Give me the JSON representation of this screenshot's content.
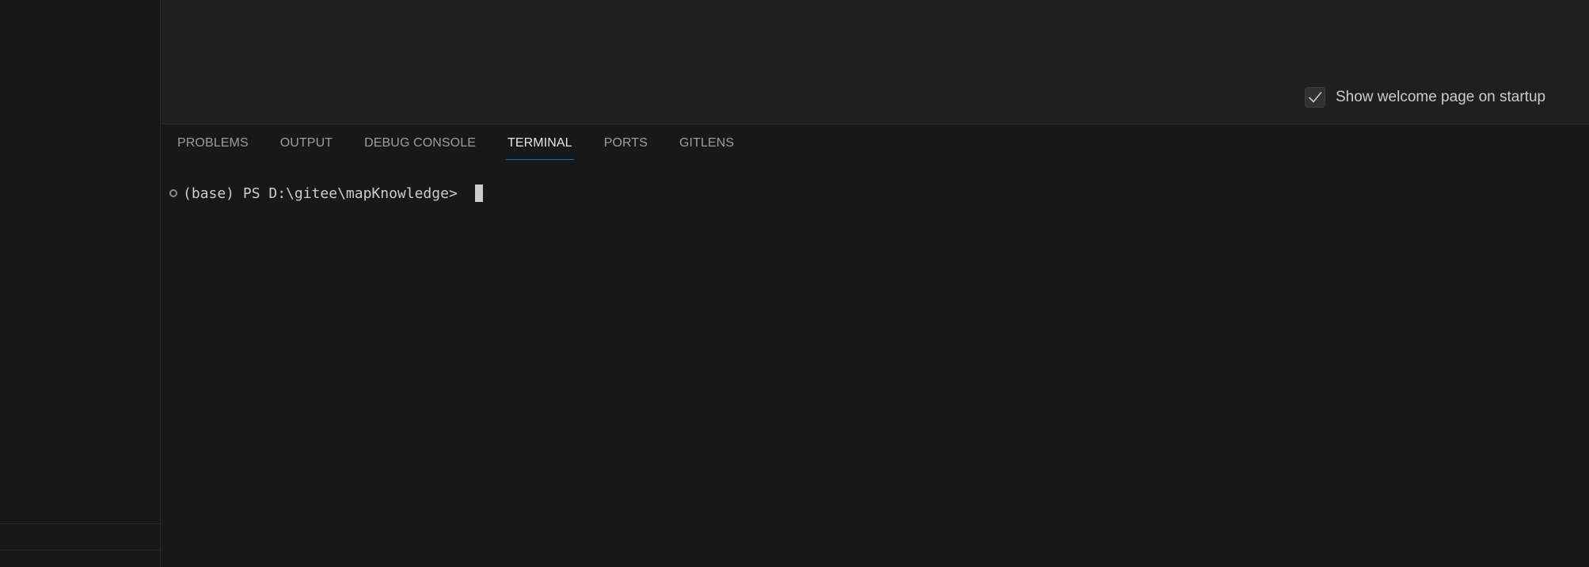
{
  "welcome": {
    "show_on_startup_label": "Show welcome page on startup",
    "show_on_startup_checked": true
  },
  "panel": {
    "tabs": [
      {
        "label": "PROBLEMS",
        "active": false
      },
      {
        "label": "OUTPUT",
        "active": false
      },
      {
        "label": "DEBUG CONSOLE",
        "active": false
      },
      {
        "label": "TERMINAL",
        "active": true
      },
      {
        "label": "PORTS",
        "active": false
      },
      {
        "label": "GITLENS",
        "active": false
      }
    ]
  },
  "terminal": {
    "prompt": "(base) PS D:\\gitee\\mapKnowledge> "
  },
  "colors": {
    "accent": "#0078d4",
    "background": "#181818",
    "editor_background": "#1f1f1f"
  },
  "icons": {
    "checkbox_check": "check-icon",
    "command_decoration": "circle-outline-icon"
  }
}
